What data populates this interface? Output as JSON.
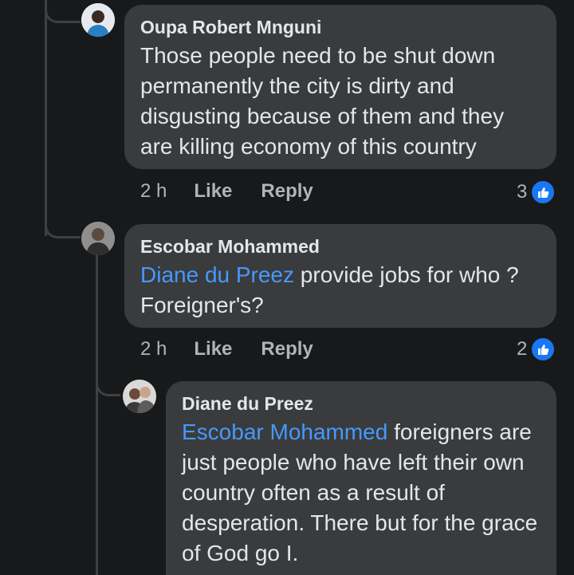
{
  "comments": [
    {
      "author": "Oupa Robert Mnguni",
      "mention": "",
      "text": "Those people need to be shut down permanently the city is dirty and disgusting because of them and they are killing economy of this country",
      "time": "2 h",
      "like_label": "Like",
      "reply_label": "Reply",
      "reaction_count": "3",
      "reaction_icon": "like-icon"
    },
    {
      "author": "Escobar Mohammed",
      "mention": "Diane du Preez",
      "text": " provide jobs for who ? Foreigner's?",
      "time": "2 h",
      "like_label": "Like",
      "reply_label": "Reply",
      "reaction_count": "2",
      "reaction_icon": "like-icon"
    },
    {
      "author": "Diane du Preez",
      "mention": "Escobar Mohammed",
      "text": " foreigners are just people who have left their own country often as a result of desperation. There but for the grace of God go I.",
      "time": "",
      "like_label": "",
      "reply_label": "",
      "reaction_count": "",
      "reaction_icon": ""
    }
  ],
  "colors": {
    "background": "#18191a",
    "bubble": "#3a3b3c",
    "mention": "#4599ff",
    "like": "#1877f2"
  }
}
